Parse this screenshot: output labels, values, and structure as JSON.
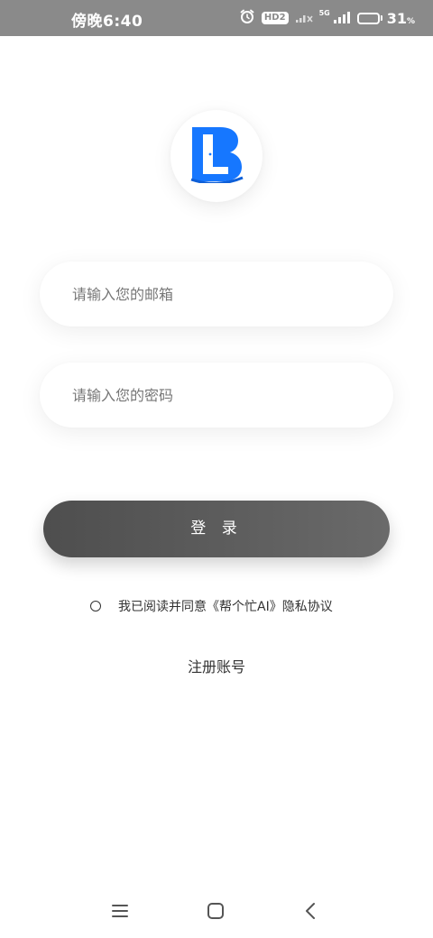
{
  "status_bar": {
    "time": "傍晚6:40",
    "hd_badge": "HD2",
    "network_label": "5G",
    "battery_level": 0.31,
    "battery_text": "31",
    "battery_unit": "%",
    "icons": [
      "alarm-icon",
      "hd-icon",
      "wifi-off-icon",
      "signal-icon",
      "battery-icon"
    ]
  },
  "logo": {
    "icon": "app-logo-icon",
    "brand_color": "#1677ff"
  },
  "form": {
    "email_placeholder": "请输入您的邮箱",
    "email_value": "",
    "password_placeholder": "请输入您的密码",
    "password_value": ""
  },
  "login_button": {
    "label": "登 录"
  },
  "agreement": {
    "checked": false,
    "text": "我已阅读并同意《帮个忙AI》隐私协议"
  },
  "register_link": {
    "label": "注册账号"
  },
  "nav_bar": {
    "icons": [
      "menu-icon",
      "home-icon",
      "back-icon"
    ]
  },
  "colors": {
    "status_bar_bg": "#8a8a8a",
    "button_dark": "#555555",
    "text": "#333333"
  }
}
